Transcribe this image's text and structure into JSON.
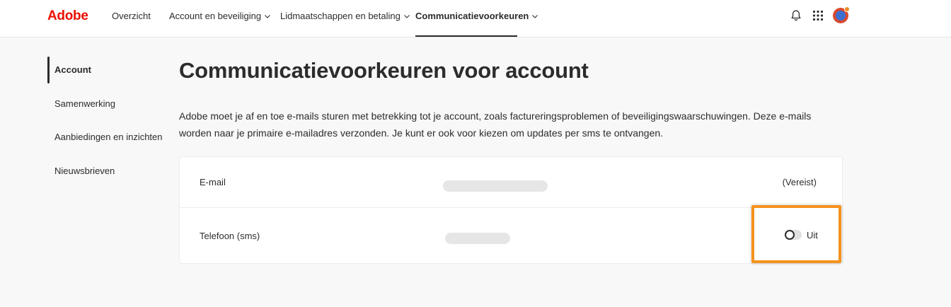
{
  "header": {
    "logo": "Adobe",
    "nav": [
      {
        "label": "Overzicht",
        "has_dropdown": false,
        "active": false
      },
      {
        "label": "Account en beveiliging",
        "has_dropdown": true,
        "active": false
      },
      {
        "label": "Lidmaatschappen en betaling",
        "has_dropdown": true,
        "active": false
      },
      {
        "label": "Communicatievoorkeuren",
        "has_dropdown": true,
        "active": true
      }
    ],
    "icons": [
      "bell-icon",
      "apps-grid-icon",
      "avatar"
    ]
  },
  "sidebar": {
    "items": [
      {
        "label": "Account",
        "active": true
      },
      {
        "label": "Samenwerking",
        "active": false
      },
      {
        "label": "Aanbiedingen en inzichten",
        "active": false
      },
      {
        "label": "Nieuwsbrieven",
        "active": false
      }
    ]
  },
  "main": {
    "title": "Communicatievoorkeuren voor account",
    "description": "Adobe moet je af en toe e-mails sturen met betrekking tot je account, zoals factureringsproblemen of beveiligingswaarschuwingen. Deze e-mails worden naar je primaire e-mailadres verzonden. Je kunt er ook voor kiezen om updates per sms te ontvangen.",
    "rows": [
      {
        "label": "E-mail",
        "status": "(Vereist)"
      },
      {
        "label": "Telefoon (sms)",
        "toggle_label": "Uit",
        "toggle_on": false
      }
    ]
  },
  "colors": {
    "brand": "#eb1000",
    "highlight": "#f5921e",
    "text": "#2c2c2c",
    "background": "#f8f8f8"
  }
}
